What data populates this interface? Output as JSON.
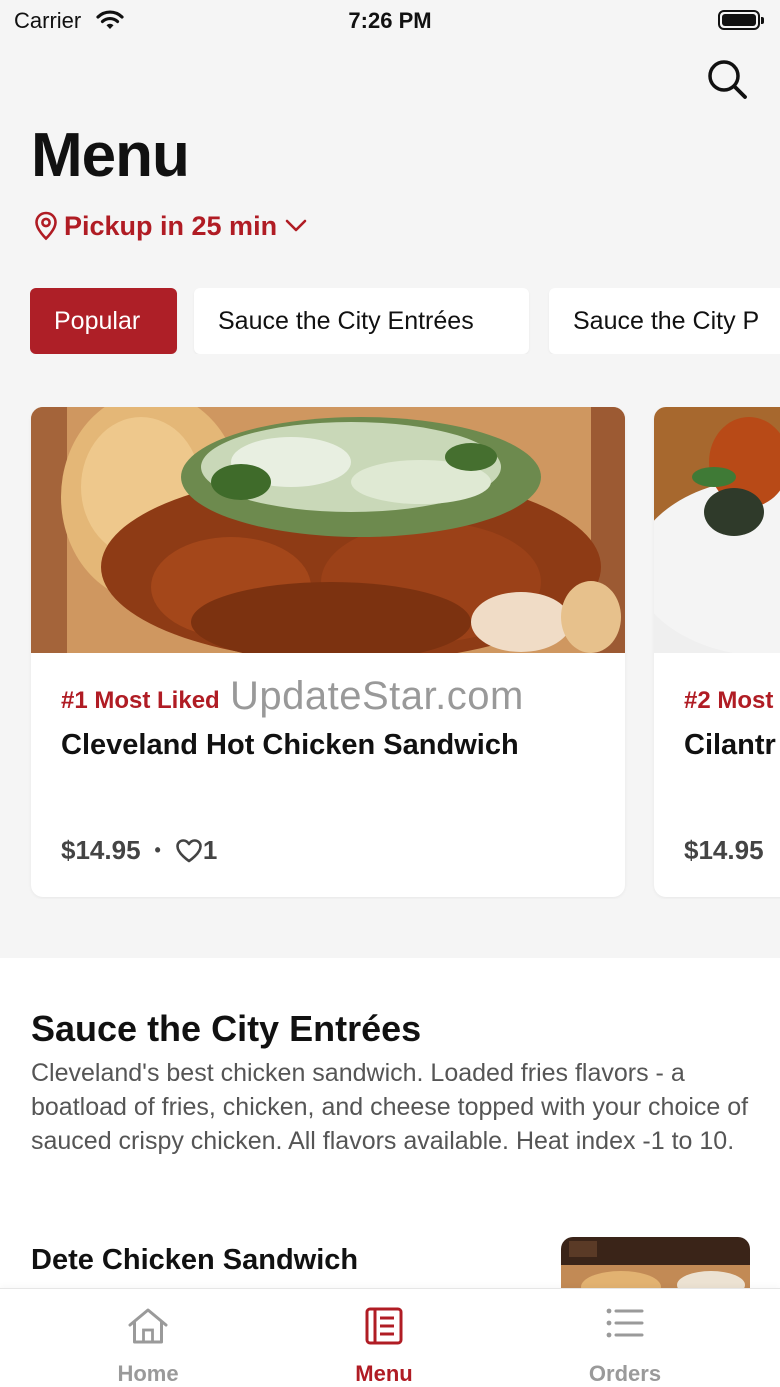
{
  "status_bar": {
    "carrier": "Carrier",
    "time": "7:26 PM"
  },
  "header": {
    "title": "Menu",
    "pickup_label": "Pickup in 25 min"
  },
  "categories": [
    {
      "label": "Popular",
      "active": true
    },
    {
      "label": "Sauce the City Entrées",
      "active": false
    },
    {
      "label": "Sauce the City P",
      "active": false
    }
  ],
  "popular_items": [
    {
      "rank": "#1 Most Liked",
      "name": "Cleveland Hot Chicken Sandwich",
      "price": "$14.95",
      "separator": "•",
      "likes": "1"
    },
    {
      "rank": "#2 Most",
      "name": "Cilantr",
      "price": "$14.95"
    }
  ],
  "watermark": "UpdateStar.com",
  "section": {
    "title": "Sauce the City Entrées",
    "description": "Cleveland's best chicken sandwich. Loaded fries flavors - a boatload of fries, chicken, and cheese topped with your choice of sauced crispy chicken. All flavors available. Heat index -1 to 10.",
    "first_item": "Dete Chicken Sandwich"
  },
  "tabbar": [
    {
      "label": "Home",
      "icon": "home-icon",
      "active": false
    },
    {
      "label": "Menu",
      "icon": "menu-icon",
      "active": true
    },
    {
      "label": "Orders",
      "icon": "orders-icon",
      "active": false
    }
  ],
  "colors": {
    "brand": "#b01c24",
    "background": "#f5f5f5",
    "inactive": "#9a9a9a"
  }
}
